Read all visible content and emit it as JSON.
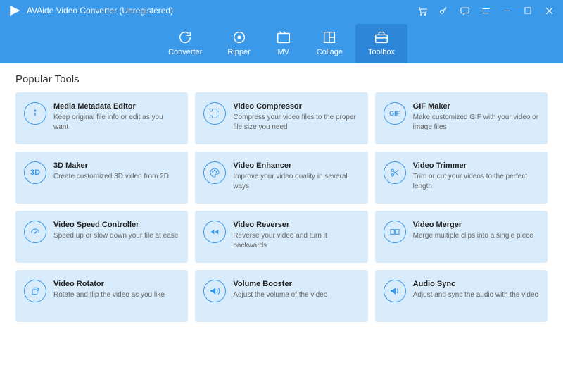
{
  "app": {
    "title": "AVAide Video Converter (Unregistered)"
  },
  "nav": {
    "items": [
      {
        "label": "Converter"
      },
      {
        "label": "Ripper"
      },
      {
        "label": "MV"
      },
      {
        "label": "Collage"
      },
      {
        "label": "Toolbox",
        "active": true
      }
    ]
  },
  "section": {
    "popular_tools_title": "Popular Tools"
  },
  "tools": [
    {
      "icon": "info",
      "title": "Media Metadata Editor",
      "desc": "Keep original file info or edit as you want"
    },
    {
      "icon": "compress",
      "title": "Video Compressor",
      "desc": "Compress your video files to the proper file size you need"
    },
    {
      "icon": "gif",
      "title": "GIF Maker",
      "desc": "Make customized GIF with your video or image files"
    },
    {
      "icon": "3d",
      "title": "3D Maker",
      "desc": "Create customized 3D video from 2D"
    },
    {
      "icon": "enhance",
      "title": "Video Enhancer",
      "desc": "Improve your video quality in several ways"
    },
    {
      "icon": "trim",
      "title": "Video Trimmer",
      "desc": "Trim or cut your videos to the perfect length"
    },
    {
      "icon": "speed",
      "title": "Video Speed Controller",
      "desc": "Speed up or slow down your file at ease"
    },
    {
      "icon": "reverse",
      "title": "Video Reverser",
      "desc": "Reverse your video and turn it backwards"
    },
    {
      "icon": "merge",
      "title": "Video Merger",
      "desc": "Merge multiple clips into a single piece"
    },
    {
      "icon": "rotate",
      "title": "Video Rotator",
      "desc": "Rotate and flip the video as you like"
    },
    {
      "icon": "volume",
      "title": "Volume Booster",
      "desc": "Adjust the volume of the video"
    },
    {
      "icon": "sync",
      "title": "Audio Sync",
      "desc": "Adjust and sync the audio with the video"
    }
  ],
  "colors": {
    "accent": "#3b99ea",
    "card_bg": "#d9ecfb"
  }
}
